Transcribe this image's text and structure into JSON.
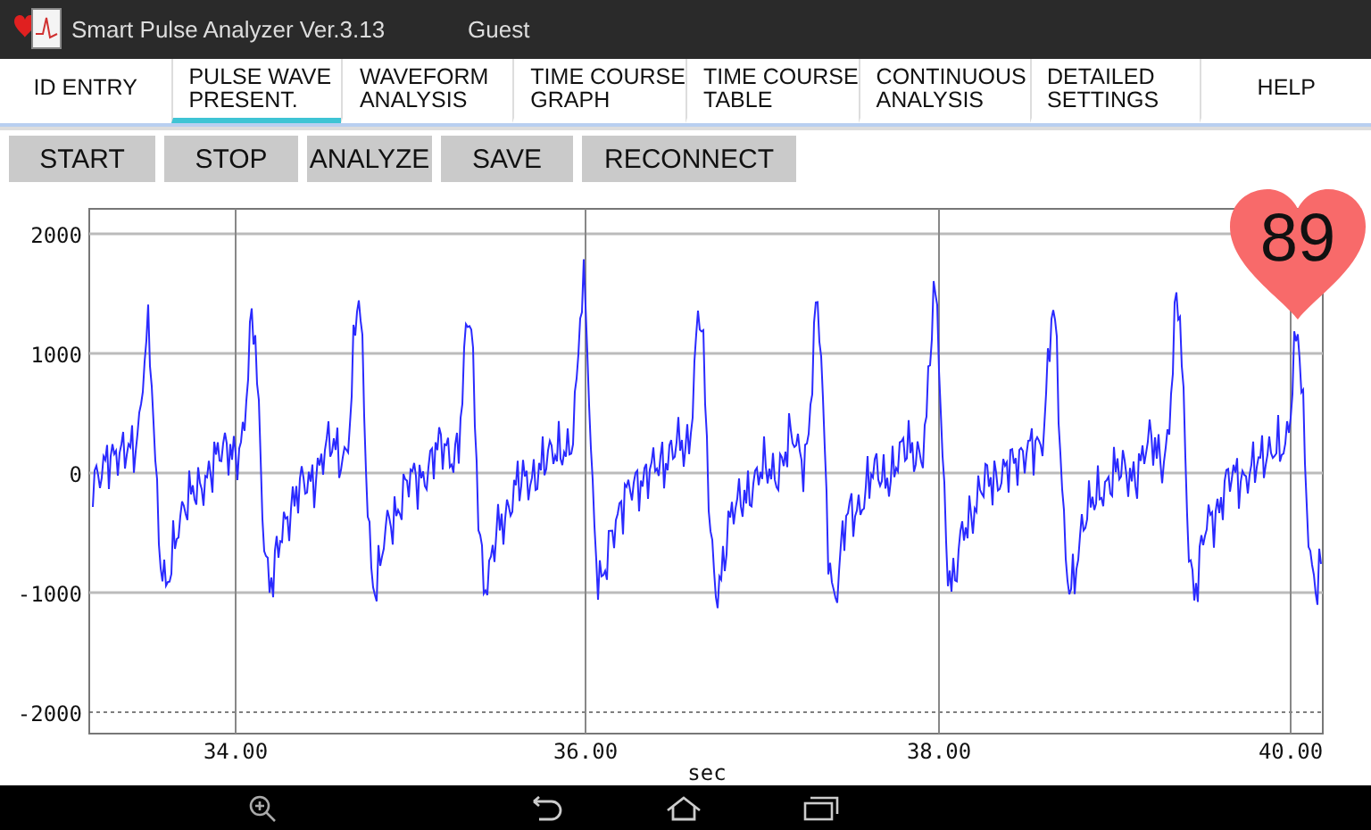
{
  "window": {
    "title": "Smart Pulse Analyzer Ver.3.13",
    "user": "Guest"
  },
  "tabs": [
    {
      "lines": [
        "ID ENTRY"
      ],
      "selected": false
    },
    {
      "lines": [
        "PULSE WAVE",
        "PRESENT."
      ],
      "selected": true
    },
    {
      "lines": [
        "WAVEFORM",
        "ANALYSIS"
      ],
      "selected": false
    },
    {
      "lines": [
        "TIME COURSE",
        "GRAPH"
      ],
      "selected": false
    },
    {
      "lines": [
        "TIME COURSE",
        "TABLE"
      ],
      "selected": false
    },
    {
      "lines": [
        "CONTINUOUS",
        "ANALYSIS"
      ],
      "selected": false
    },
    {
      "lines": [
        "DETAILED",
        "SETTINGS"
      ],
      "selected": false
    },
    {
      "lines": [
        "HELP"
      ],
      "selected": false
    }
  ],
  "buttons": [
    "START",
    "STOP",
    "ANALYZE",
    "SAVE",
    "RECONNECT"
  ],
  "chart": {
    "y_ticks": [
      "2000",
      "1000",
      "0",
      "-1000",
      "-2000"
    ],
    "x_ticks": [
      "34.00",
      "36.00",
      "38.00",
      "40.00"
    ],
    "xlabel": "sec"
  },
  "heart_rate": "89"
}
